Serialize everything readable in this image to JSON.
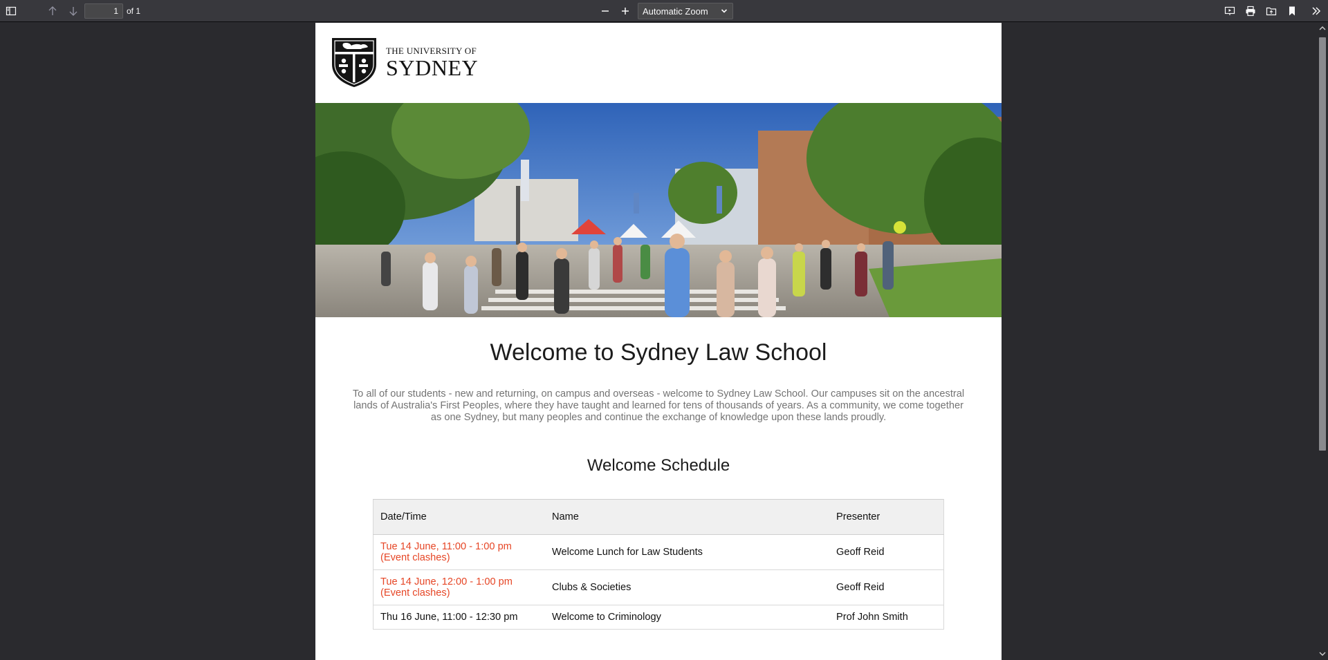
{
  "toolbar": {
    "page_number": "1",
    "page_count": "of 1",
    "zoom": "Automatic Zoom",
    "icons": {
      "sidebar": "sidebar-toggle-icon",
      "prev": "arrow-up-icon",
      "next": "arrow-down-icon",
      "zoom_out": "minus-icon",
      "zoom_in": "plus-icon",
      "presentation": "presentation-mode-icon",
      "print": "print-icon",
      "open": "open-file-icon",
      "bookmark": "bookmark-icon",
      "tools": "double-chevron-right-icon"
    }
  },
  "document": {
    "logo": {
      "line1": "THE UNIVERSITY OF",
      "line2": "SYDNEY"
    },
    "hero_image": "campus-crowd-photo",
    "title": "Welcome to Sydney Law School",
    "intro": "To all of our students - new and returning, on campus and overseas - welcome to Sydney Law School. Our campuses sit on the ancestral lands of Australia's First Peoples, where they have taught and learned for tens of thousands of years. As a community, we come together as one Sydney, but many peoples and continue the exchange of knowledge upon these lands proudly.",
    "schedule": {
      "title": "Welcome Schedule",
      "headers": [
        "Date/Time",
        "Name",
        "Presenter"
      ],
      "rows": [
        {
          "date": "Tue 14 June, 11:00 - 1:00 pm",
          "note": "(Event clashes)",
          "name": "Welcome Lunch for Law Students",
          "presenter": "Geoff Reid"
        },
        {
          "date": "Tue 14 June, 12:00 - 1:00 pm",
          "note": "(Event clashes)",
          "name": "Clubs & Societies",
          "presenter": "Geoff Reid"
        },
        {
          "date": "Thu 16 June, 11:00 - 12:30 pm",
          "name": "Welcome to Criminology",
          "presenter": "Prof John Smith"
        }
      ]
    }
  },
  "colors": {
    "toolbar_bg": "#38383d",
    "viewer_bg": "#2a2a2e",
    "clash_text": "#e64626",
    "intro_text": "#737373"
  }
}
